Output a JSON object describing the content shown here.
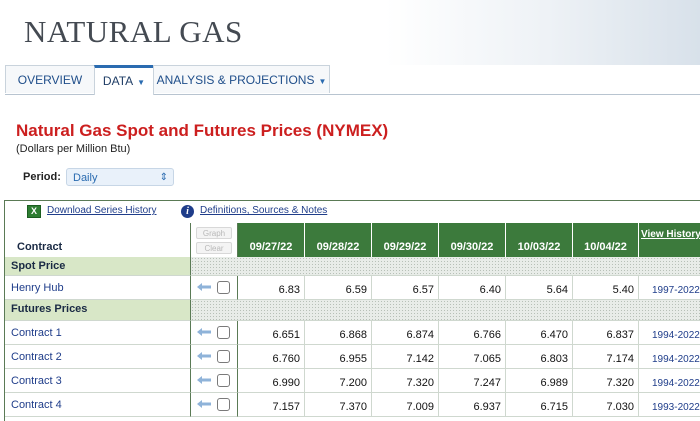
{
  "site": {
    "title": "NATURAL GAS"
  },
  "nav": {
    "tabs": [
      {
        "label": "OVERVIEW"
      },
      {
        "label": "DATA"
      },
      {
        "label": "ANALYSIS & PROJECTIONS"
      }
    ],
    "active_tab": "DATA"
  },
  "page": {
    "heading": "Natural Gas Spot and Futures Prices (NYMEX)",
    "subheading": "(Dollars per Million Btu)",
    "period_label": "Period:",
    "period_value": "Daily"
  },
  "links": {
    "download": "Download Series History",
    "definitions": "Definitions, Sources & Notes"
  },
  "table": {
    "contract_header": "Contract",
    "graph_button": "Graph",
    "clear_button": "Clear",
    "dates": [
      "09/27/22",
      "09/28/22",
      "09/29/22",
      "09/30/22",
      "10/03/22",
      "10/04/22"
    ],
    "view_history_header": "View History",
    "sections": [
      {
        "title": "Spot Price",
        "rows": [
          {
            "name": "Henry Hub",
            "values": [
              "6.83",
              "6.59",
              "6.57",
              "6.40",
              "5.64",
              "5.40"
            ],
            "history": "1997-2022"
          }
        ]
      },
      {
        "title": "Futures Prices",
        "rows": [
          {
            "name": "Contract 1",
            "values": [
              "6.651",
              "6.868",
              "6.874",
              "6.766",
              "6.470",
              "6.837"
            ],
            "history": "1994-2022"
          },
          {
            "name": "Contract 2",
            "values": [
              "6.760",
              "6.955",
              "7.142",
              "7.065",
              "6.803",
              "7.174"
            ],
            "history": "1994-2022"
          },
          {
            "name": "Contract 3",
            "values": [
              "6.990",
              "7.200",
              "7.320",
              "7.247",
              "6.989",
              "7.320"
            ],
            "history": "1994-2022"
          },
          {
            "name": "Contract 4",
            "values": [
              "7.157",
              "7.370",
              "7.009",
              "6.937",
              "6.715",
              "7.030"
            ],
            "history": "1993-2022"
          }
        ]
      }
    ]
  },
  "colors": {
    "heading_red": "#cc1f1f",
    "header_green": "#3c7a3c",
    "section_green": "#d8e7c7",
    "link_blue": "#1f3d8a"
  }
}
